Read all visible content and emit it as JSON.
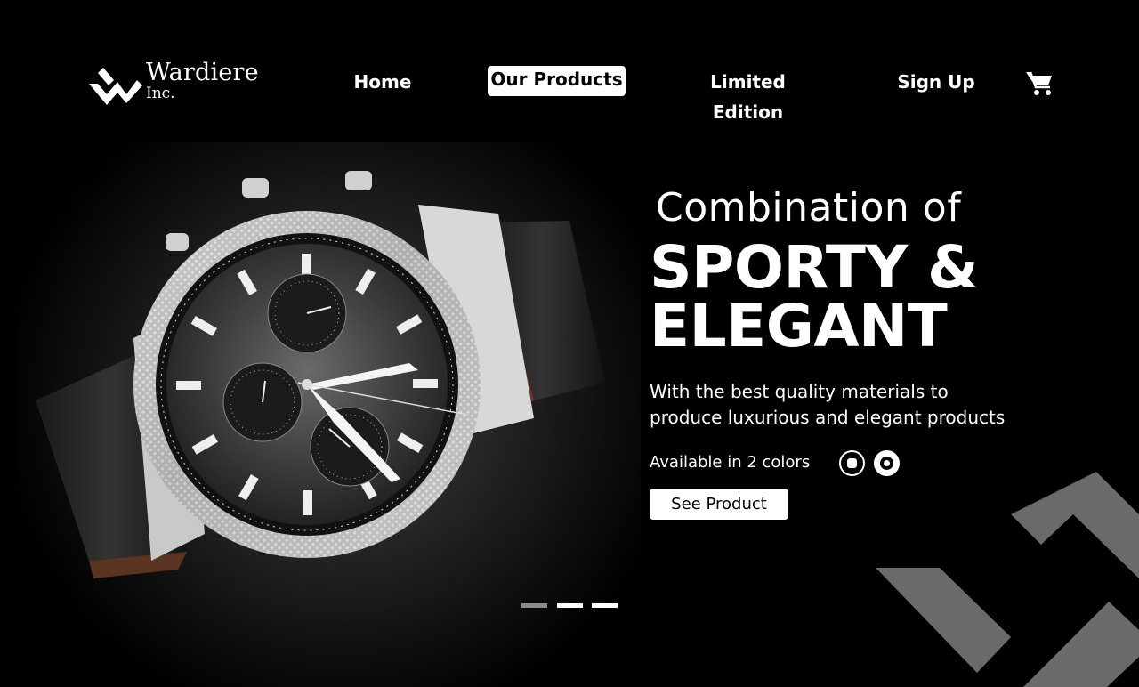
{
  "brand": {
    "name": "Wardiere",
    "sub": "Inc."
  },
  "nav": {
    "items": [
      {
        "label": "Home",
        "active": false
      },
      {
        "label": "Our Products",
        "active": true
      },
      {
        "label": "Limited Edition",
        "active": false
      },
      {
        "label": "Sign Up",
        "active": false
      }
    ],
    "cart_icon": "shopping-cart-icon"
  },
  "hero": {
    "eyebrow": "Combination of",
    "headline_line1": "SPORTY &",
    "headline_line2": "ELEGANT",
    "description_line1": "With the best quality materials to",
    "description_line2": "produce luxurious and elegant products",
    "colors_label": "Available in 2 colors",
    "color_options": [
      {
        "name": "black",
        "hex": "#000000",
        "selected": false
      },
      {
        "name": "white",
        "hex": "#ffffff",
        "selected": true
      }
    ],
    "cta_label": "See Product"
  },
  "carousel": {
    "slides": 3,
    "active_index": 0
  },
  "colors": {
    "background": "#000000",
    "text": "#ffffff",
    "accent_gray": "#6a6a6a"
  }
}
